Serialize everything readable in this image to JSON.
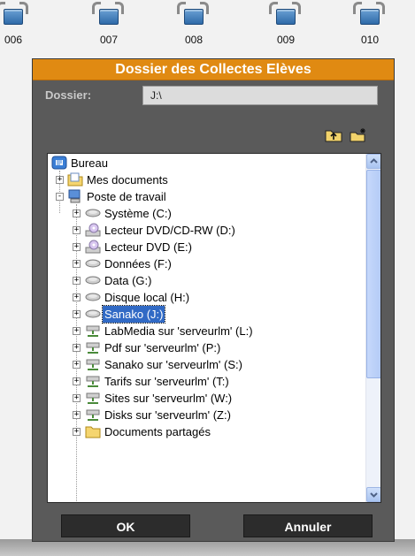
{
  "stations": [
    "006",
    "007",
    "008",
    "009",
    "010"
  ],
  "dialog": {
    "title": "Dossier des Collectes Elèves",
    "folder_label": "Dossier:",
    "folder_value": "J:\\",
    "toolbar": {
      "up_icon": "folder-up-icon",
      "new_folder_icon": "new-folder-icon"
    },
    "tree": [
      {
        "label": "Bureau",
        "icon": "desktop-icon",
        "level": 0,
        "expander": ""
      },
      {
        "label": "Mes documents",
        "icon": "documents-folder-icon",
        "level": 1,
        "expander": "+"
      },
      {
        "label": "Poste de travail",
        "icon": "computer-icon",
        "level": 1,
        "expander": "-"
      },
      {
        "label": "Système (C:)",
        "icon": "hard-drive-icon",
        "level": 2,
        "expander": "+"
      },
      {
        "label": "Lecteur DVD/CD-RW (D:)",
        "icon": "dvd-drive-icon",
        "level": 2,
        "expander": "+"
      },
      {
        "label": "Lecteur DVD (E:)",
        "icon": "dvd-drive-icon",
        "level": 2,
        "expander": "+"
      },
      {
        "label": "Données (F:)",
        "icon": "hard-drive-icon",
        "level": 2,
        "expander": "+"
      },
      {
        "label": "Data (G:)",
        "icon": "hard-drive-icon",
        "level": 2,
        "expander": "+"
      },
      {
        "label": "Disque local (H:)",
        "icon": "hard-drive-icon",
        "level": 2,
        "expander": "+"
      },
      {
        "label": "Sanako (J:)",
        "icon": "hard-drive-icon",
        "level": 2,
        "expander": "+",
        "selected": true
      },
      {
        "label": "LabMedia sur 'serveurlm' (L:)",
        "icon": "network-drive-icon",
        "level": 2,
        "expander": "+"
      },
      {
        "label": "Pdf sur 'serveurlm' (P:)",
        "icon": "network-drive-icon",
        "level": 2,
        "expander": "+"
      },
      {
        "label": "Sanako sur 'serveurlm' (S:)",
        "icon": "network-drive-icon",
        "level": 2,
        "expander": "+"
      },
      {
        "label": "Tarifs sur 'serveurlm' (T:)",
        "icon": "network-drive-icon",
        "level": 2,
        "expander": "+"
      },
      {
        "label": "Sites sur 'serveurlm' (W:)",
        "icon": "network-drive-icon",
        "level": 2,
        "expander": "+"
      },
      {
        "label": "Disks sur 'serveurlm' (Z:)",
        "icon": "network-drive-icon",
        "level": 2,
        "expander": "+"
      },
      {
        "label": "Documents partagés",
        "icon": "shared-folder-icon",
        "level": 2,
        "expander": "+"
      }
    ],
    "ok_label": "OK",
    "cancel_label": "Annuler"
  },
  "colors": {
    "title_bar": "#e08a12",
    "dialog_bg": "#5a5a5a",
    "selection": "#316ac5"
  }
}
